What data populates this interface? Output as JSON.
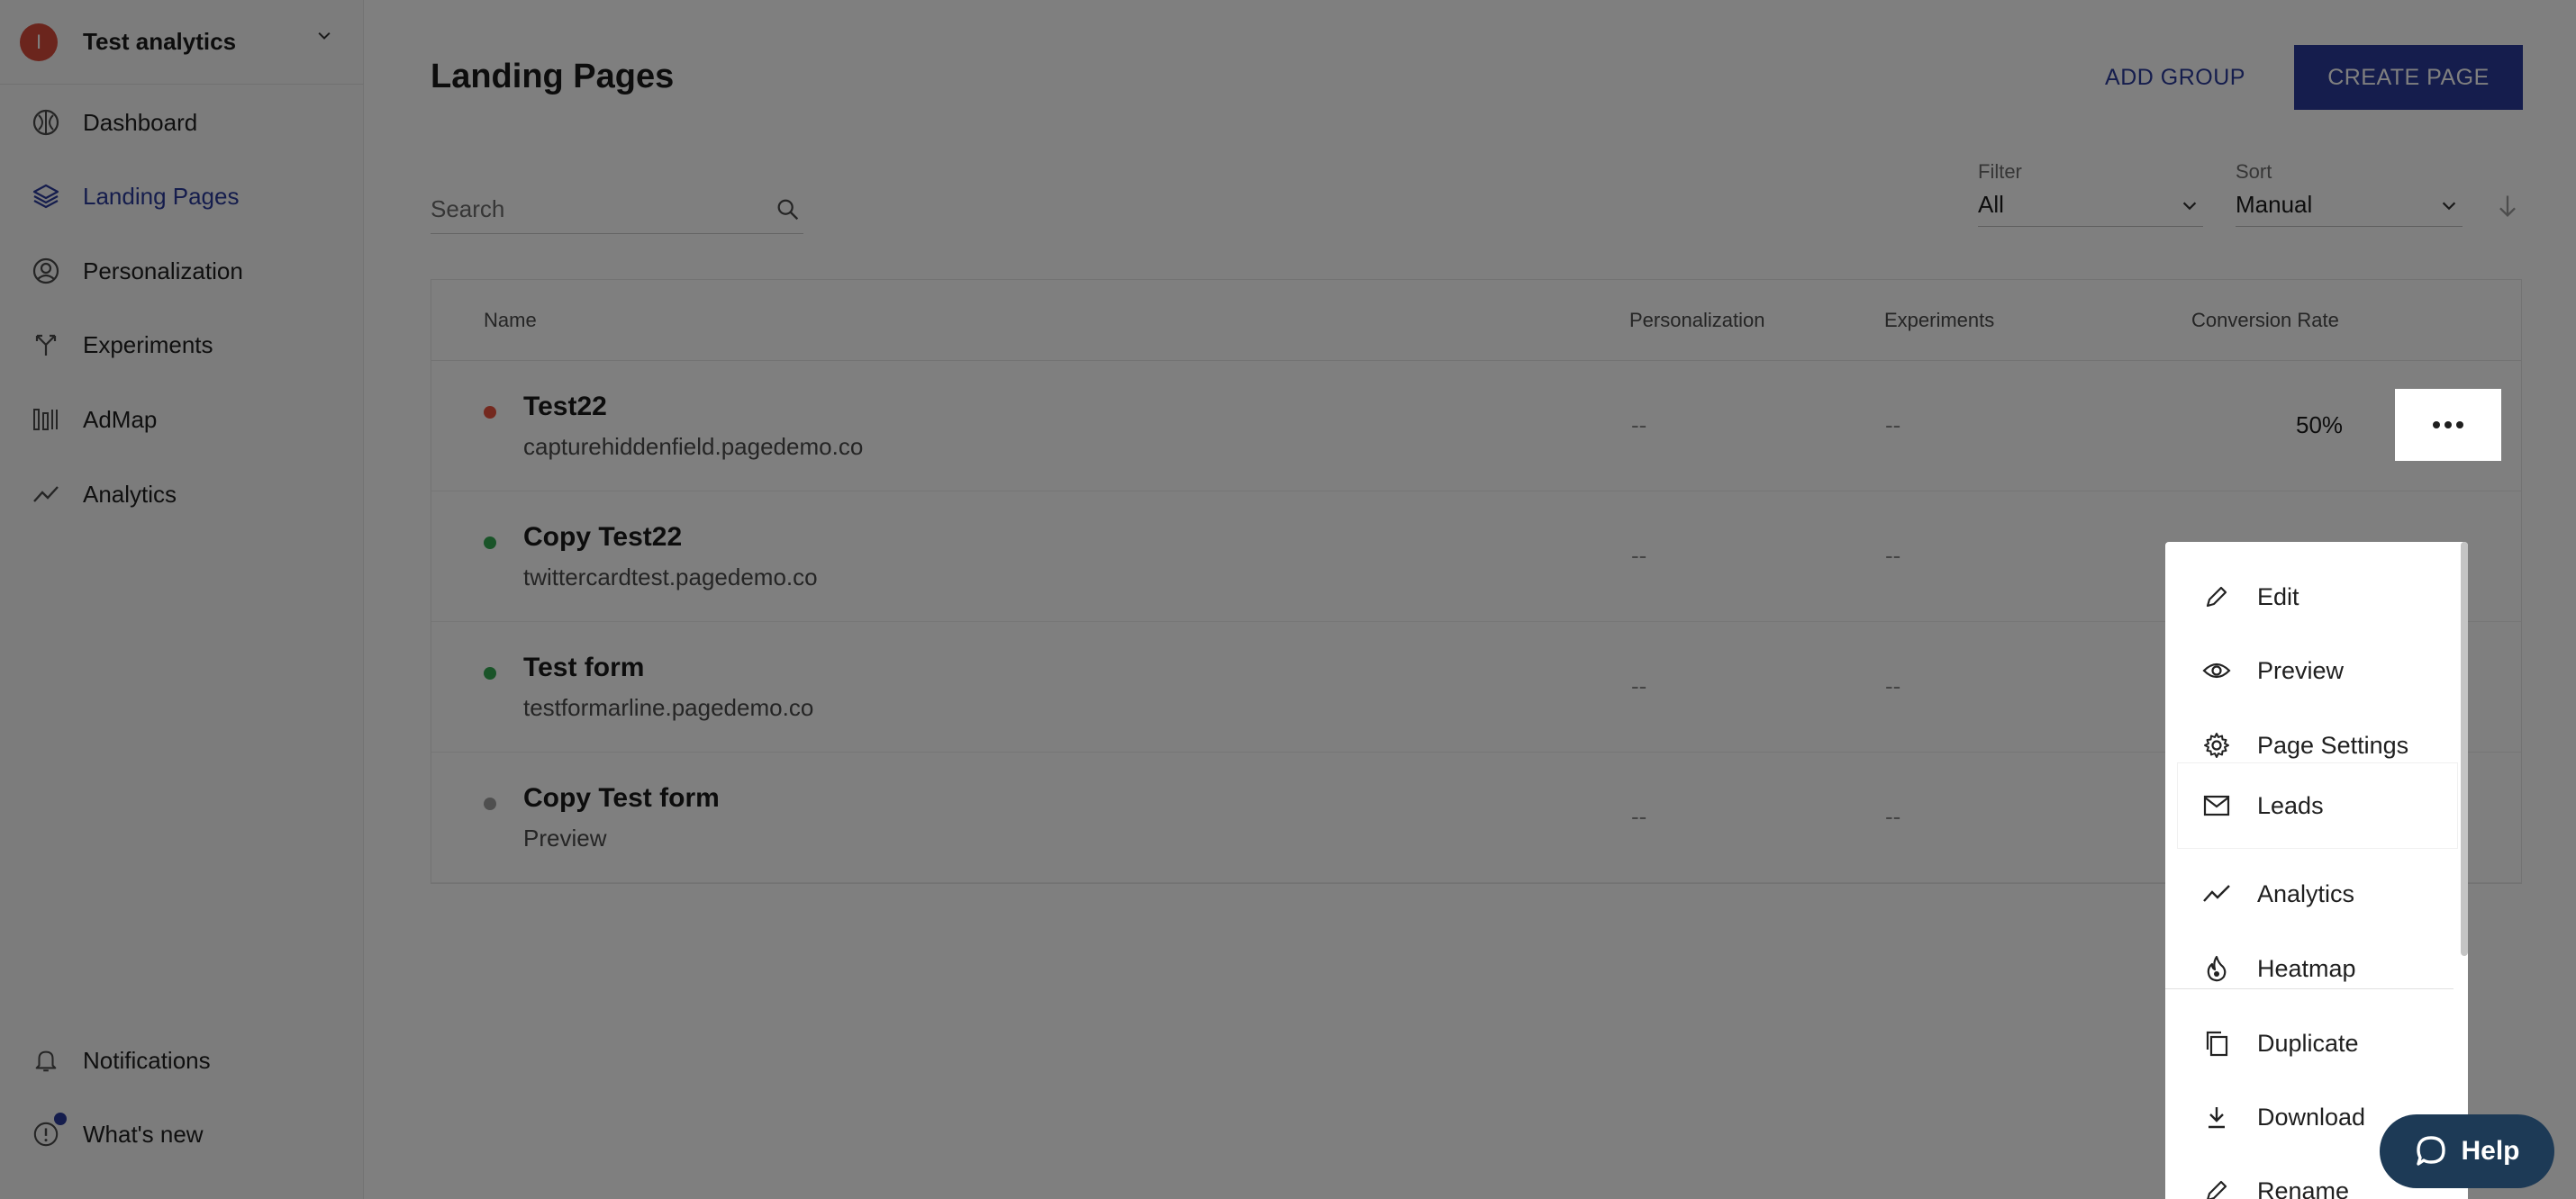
{
  "workspace": {
    "avatar_letter": "I",
    "name": "Test analytics"
  },
  "sidebar": {
    "items": [
      {
        "label": "Dashboard",
        "icon": "dashboard-icon"
      },
      {
        "label": "Landing Pages",
        "icon": "layers-icon",
        "active": true
      },
      {
        "label": "Personalization",
        "icon": "user-circle-icon"
      },
      {
        "label": "Experiments",
        "icon": "split-arrow-icon"
      },
      {
        "label": "AdMap",
        "icon": "admap-icon"
      },
      {
        "label": "Analytics",
        "icon": "trend-line-icon"
      }
    ],
    "bottom": [
      {
        "label": "Notifications",
        "icon": "bell-icon"
      },
      {
        "label": "What's new",
        "icon": "info-circle-icon"
      }
    ]
  },
  "header": {
    "title": "Landing Pages",
    "add_group": "ADD GROUP",
    "create_page": "CREATE PAGE"
  },
  "search": {
    "placeholder": "Search"
  },
  "filter": {
    "label": "Filter",
    "value": "All"
  },
  "sort": {
    "label": "Sort",
    "value": "Manual"
  },
  "table": {
    "columns": {
      "name": "Name",
      "personalization": "Personalization",
      "experiments": "Experiments",
      "conversion": "Conversion Rate"
    },
    "rows": [
      {
        "name": "Test22",
        "domain": "capturehiddenfield.pagedemo.co",
        "personalization": "--",
        "experiments": "--",
        "conversion": "50%",
        "status_color": "#e8533f"
      },
      {
        "name": "Copy Test22",
        "domain": "twittercardtest.pagedemo.co",
        "personalization": "--",
        "experiments": "--",
        "conversion": "",
        "status_color": "#34a853"
      },
      {
        "name": "Test form",
        "domain": "testformarline.pagedemo.co",
        "personalization": "--",
        "experiments": "--",
        "conversion": "",
        "status_color": "#34a853"
      },
      {
        "name": "Copy Test form",
        "domain": "Preview",
        "personalization": "--",
        "experiments": "--",
        "conversion": "",
        "status_color": "#9e9e9e"
      }
    ]
  },
  "menu": {
    "items": [
      {
        "label": "Edit",
        "icon": "pencil-icon"
      },
      {
        "label": "Preview",
        "icon": "eye-icon"
      },
      {
        "label": "Page Settings",
        "icon": "gear-icon"
      },
      {
        "label": "Leads",
        "icon": "mail-icon",
        "highlighted": true
      },
      {
        "label": "Analytics",
        "icon": "trend-line-icon"
      },
      {
        "label": "Heatmap",
        "icon": "flame-icon"
      },
      {
        "label": "Duplicate",
        "icon": "copy-icon"
      },
      {
        "label": "Download",
        "icon": "download-icon"
      },
      {
        "label": "Rename",
        "icon": "pencil-icon"
      }
    ]
  },
  "help": {
    "label": "Help",
    "icon": "chat-bubble-icon"
  },
  "colors": {
    "accent": "#2b3a9a",
    "help_bg": "#1d3a56",
    "overlay": "rgba(0,0,0,0.5)"
  }
}
